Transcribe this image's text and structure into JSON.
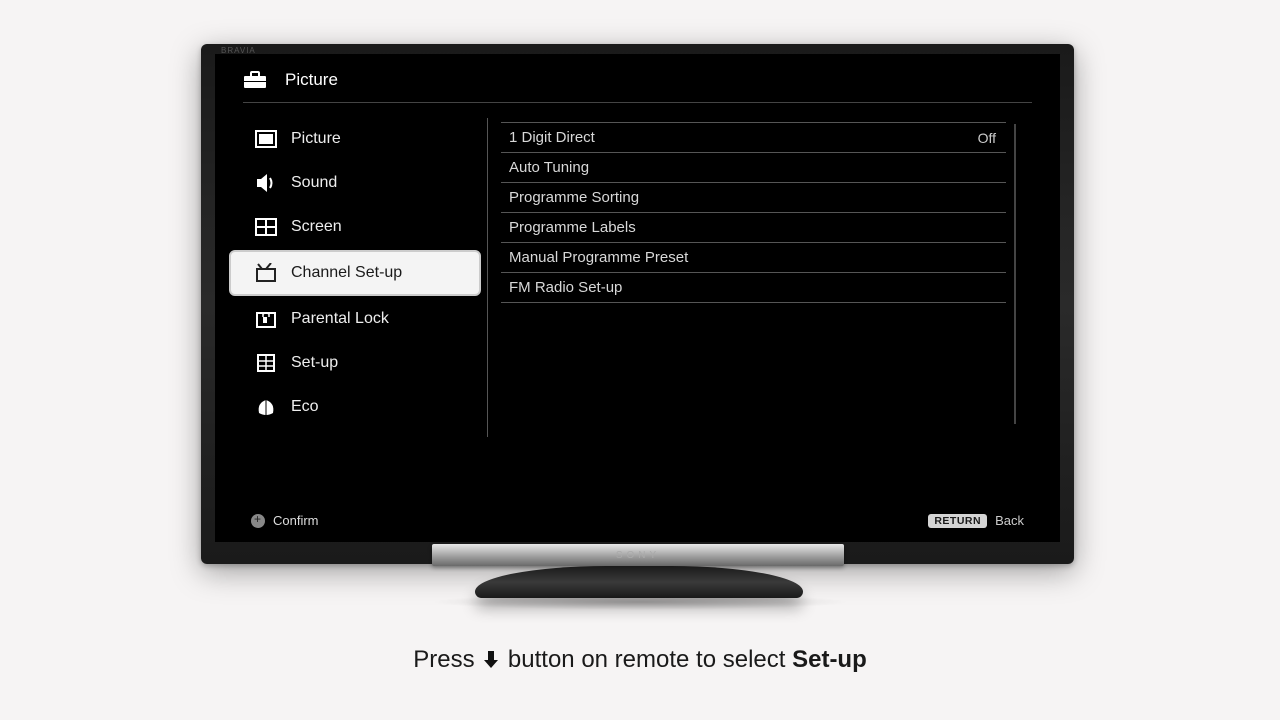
{
  "header": {
    "title": "Picture"
  },
  "sidebar": {
    "items": [
      {
        "label": "Picture",
        "icon": "picture-icon",
        "selected": false
      },
      {
        "label": "Sound",
        "icon": "sound-icon",
        "selected": false
      },
      {
        "label": "Screen",
        "icon": "screen-icon",
        "selected": false
      },
      {
        "label": "Channel Set-up",
        "icon": "channel-icon",
        "selected": true
      },
      {
        "label": "Parental Lock",
        "icon": "lock-icon",
        "selected": false
      },
      {
        "label": "Set-up",
        "icon": "setup-icon",
        "selected": false
      },
      {
        "label": "Eco",
        "icon": "eco-icon",
        "selected": false
      }
    ]
  },
  "submenu": {
    "rows": [
      {
        "label": "1 Digit Direct",
        "value": "Off"
      },
      {
        "label": "Auto Tuning",
        "value": ""
      },
      {
        "label": "Programme Sorting",
        "value": ""
      },
      {
        "label": "Programme Labels",
        "value": ""
      },
      {
        "label": "Manual Programme Preset",
        "value": ""
      },
      {
        "label": "FM Radio Set-up",
        "value": ""
      }
    ]
  },
  "footer": {
    "confirm_label": "Confirm",
    "return_badge": "RETURN",
    "back_label": "Back"
  },
  "tv_brand": "SONY",
  "instruction": {
    "prefix": "Press ",
    "mid": " button on remote to select ",
    "target": "Set-up"
  }
}
